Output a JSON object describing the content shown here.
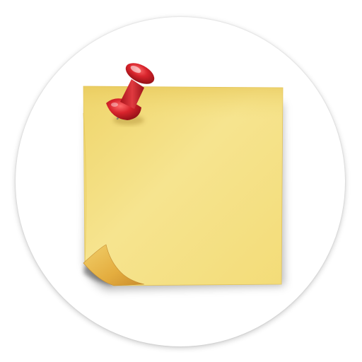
{
  "icon": {
    "name": "sticky-note-with-pushpin-icon",
    "note_color": "#f3dd7a",
    "note_edge_color": "#e6c657",
    "curl_color": "#e9b94c",
    "pin_color": "#d6262e",
    "background_color": "#ffffff"
  }
}
